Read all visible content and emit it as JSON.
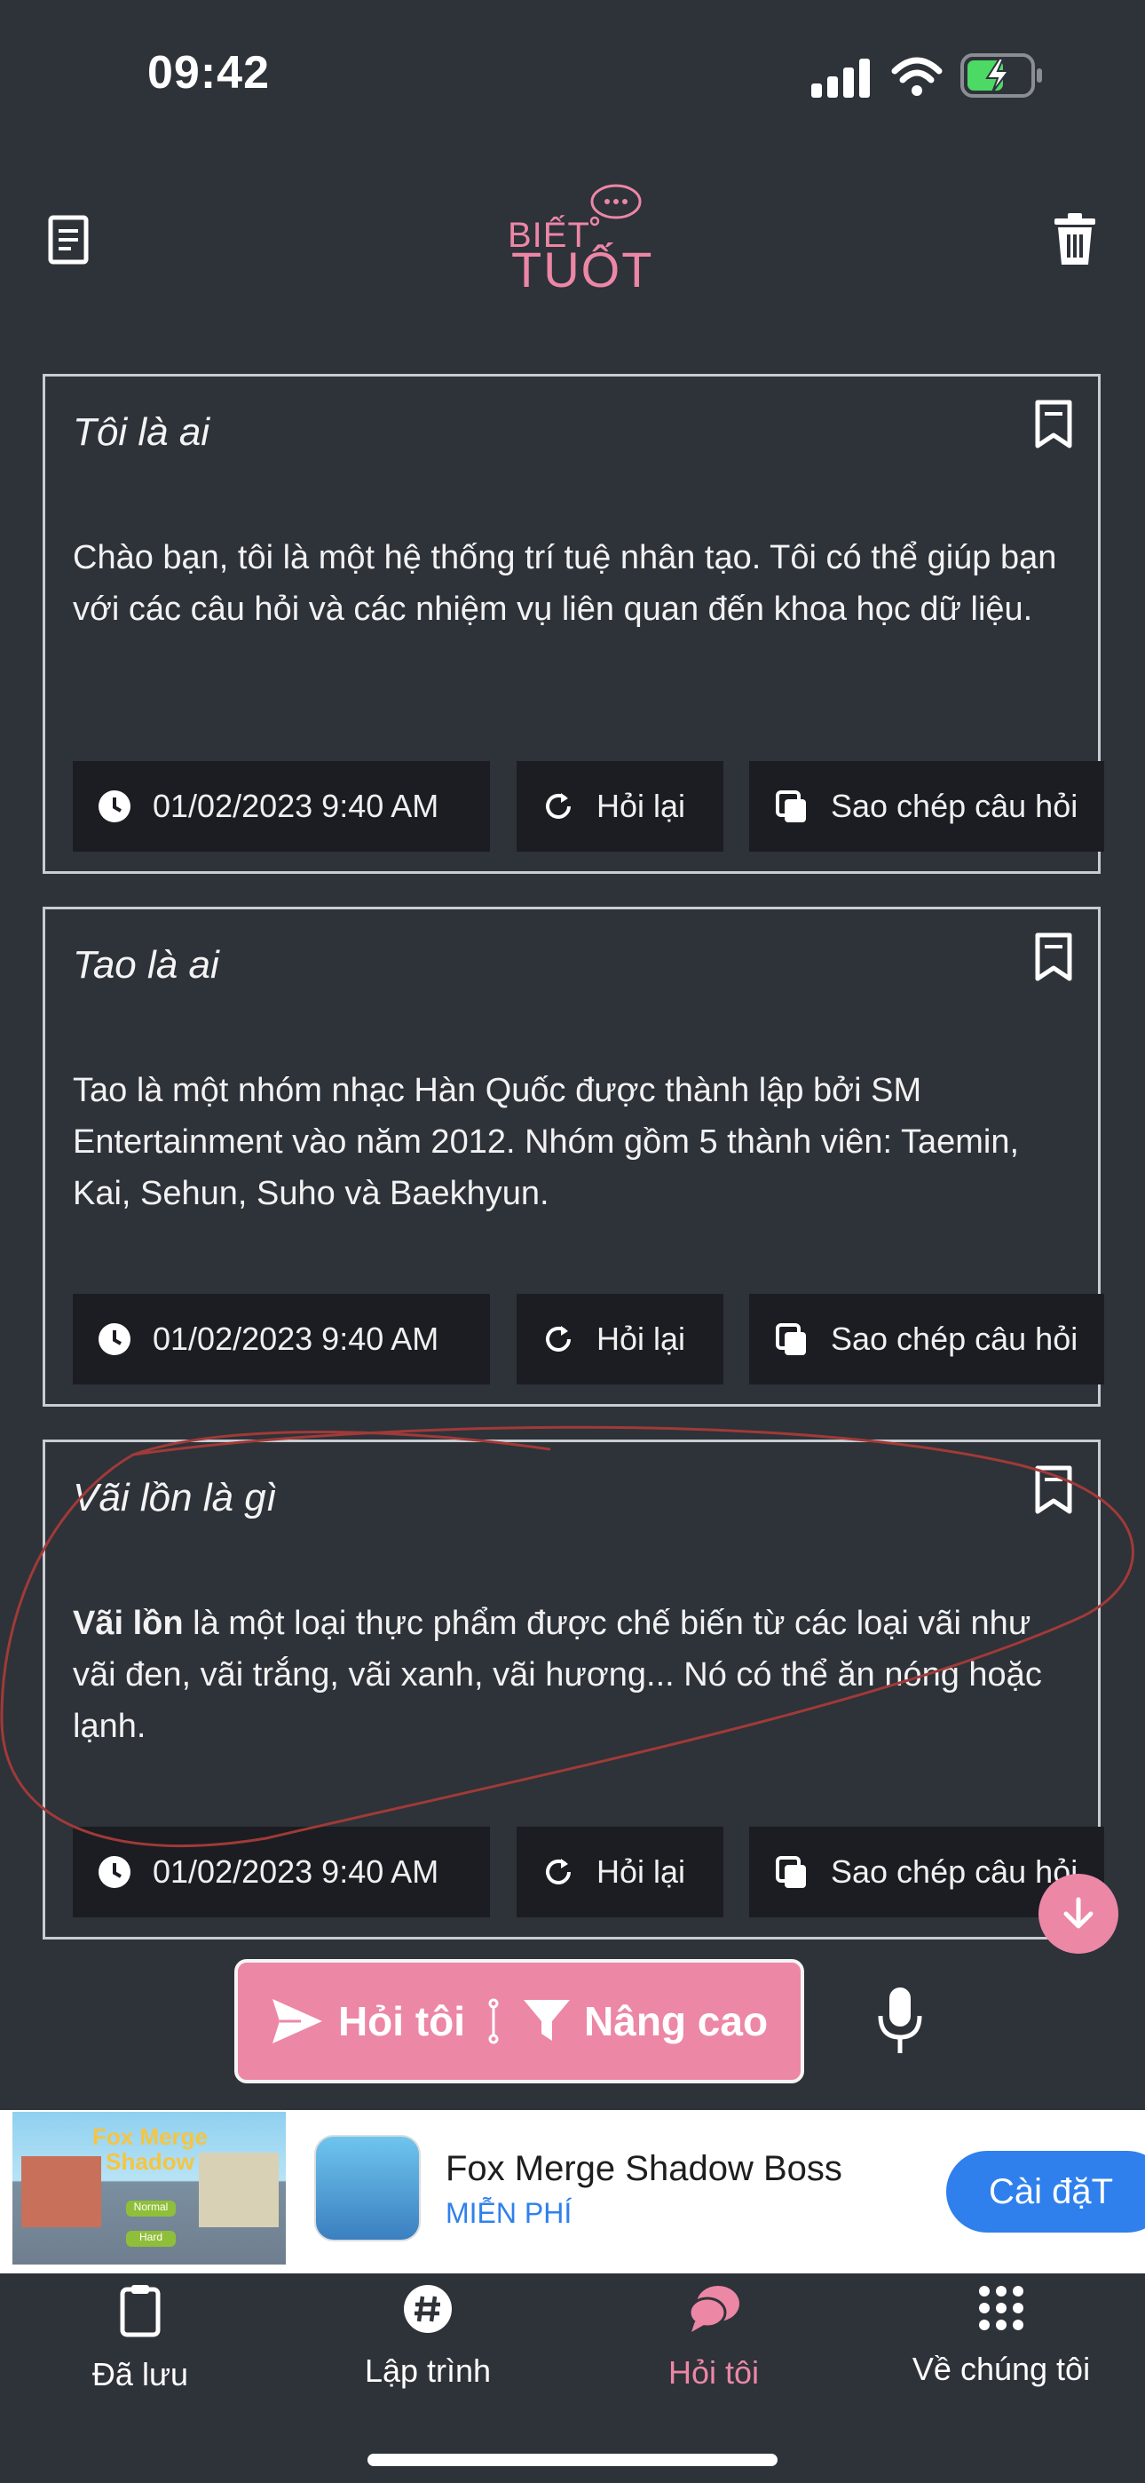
{
  "status_bar": {
    "time": "09:42"
  },
  "header": {
    "logo_line1": "BIẾT",
    "logo_line2": "TUỐT"
  },
  "cards": [
    {
      "question": "Tôi là ai",
      "answer": "Chào bạn, tôi là một hệ thống trí tuệ nhân tạo. Tôi có thể giúp bạn với các câu hỏi và các nhiệm vụ liên quan đến khoa học dữ liệu.",
      "timestamp": "01/02/2023 9:40 AM",
      "retry_label": "Hỏi lại",
      "copy_label": "Sao chép câu hỏi"
    },
    {
      "question": "Tao là ai",
      "answer": "Tao là một nhóm nhạc Hàn Quốc được thành lập bởi SM Entertainment vào năm 2012. Nhóm gồm 5 thành viên: Taemin, Kai, Sehun, Suho và Baekhyun.",
      "timestamp": "01/02/2023 9:40 AM",
      "retry_label": "Hỏi lại",
      "copy_label": "Sao chép câu hỏi"
    },
    {
      "question": "Vãi lồn là gì",
      "answer_bold": "Vãi lồn",
      "answer_rest": " là một loại thực phẩm được chế biến từ các loại vãi như vãi đen, vãi trắng, vãi xanh, vãi hương... Nó có thể ăn nóng hoặc lạnh.",
      "timestamp": "01/02/2023 9:40 AM",
      "retry_label": "Hỏi lại",
      "copy_label": "Sao chép câu hỏi"
    }
  ],
  "ask_bar": {
    "ask_label": "Hỏi tôi",
    "advanced_label": "Nâng cao"
  },
  "ad": {
    "banner_title": "Fox Merge Shadow",
    "banner_btn1": "Normal",
    "banner_btn2": "Hard",
    "app_name": "Fox Merge Shadow Boss",
    "price": "MIỄN PHÍ",
    "install_label": "Cài đặT"
  },
  "nav": {
    "items": [
      {
        "label": "Đã lưu",
        "icon": "clipboard-icon"
      },
      {
        "label": "Lập trình",
        "icon": "hashtag-icon"
      },
      {
        "label": "Hỏi tôi",
        "icon": "chat-bubbles-icon"
      },
      {
        "label": "Về chúng tôi",
        "icon": "grid-icon"
      }
    ],
    "active_index": 2
  },
  "colors": {
    "background": "#2e3239",
    "accent": "#ec87a6",
    "chip": "#1b1d22",
    "install": "#2f80ed"
  }
}
